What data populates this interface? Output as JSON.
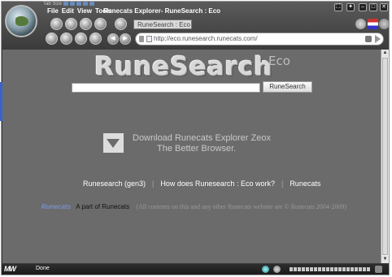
{
  "tab_size_label": "Tab Size",
  "menu": [
    "File",
    "Edit",
    "View",
    "Tools"
  ],
  "window_title": "Runecats Explorer- RuneSearch : Eco",
  "toolbar_title": "RuneSearch : Eco",
  "address": "http://eco.runesearch.runecats.com/",
  "page": {
    "logo_main": "RuneSearch",
    "logo_eco": "Eco",
    "search_button": "RuneSearch",
    "download_line1": "Download Runecats Explorer Zeox",
    "download_line2": "The Better Browser.",
    "links": [
      "Runesearch (gen3)",
      "How does Runesearch : Eco work?",
      "Runecats"
    ],
    "footer_brand": "Runecats",
    "footer_part": "A part of Runecats",
    "footer_copy": "(All contents on this and any other Runecats website are © Runecats 2004-2009)"
  },
  "status": {
    "logo": "MW",
    "text": "Done"
  },
  "icons": [
    "globe-icon",
    "back-arrow-icon",
    "forward-arrow-icon",
    "page-icon",
    "go-arrow-icon",
    "flag-icon",
    "close-icon",
    "maximize-icon",
    "minimize-icon",
    "fullscreen-icon",
    "download-arrow-icon"
  ],
  "colors": {
    "content_bg": "#6b6b6b",
    "chrome_bg": "#3b3b3b",
    "link_text": "#ffffff",
    "logo_text": "#d8d8d8"
  }
}
